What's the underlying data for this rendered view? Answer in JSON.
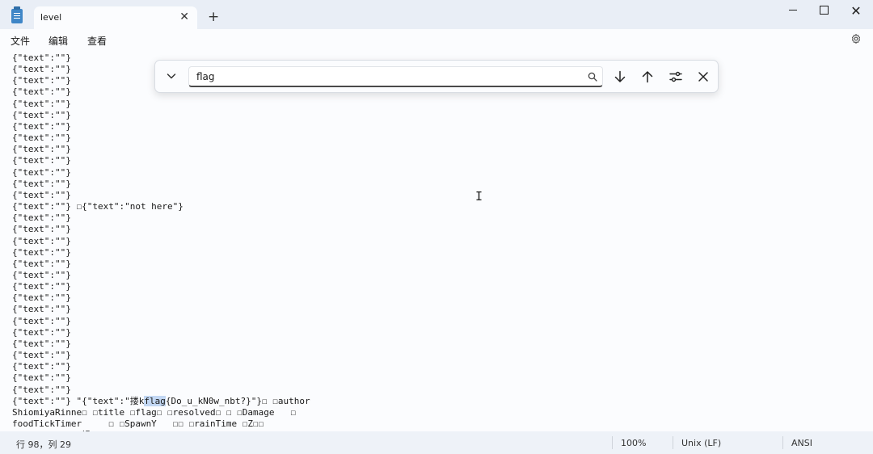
{
  "window": {
    "tab_title": "level",
    "tab_close": "✕",
    "new_tab": "+",
    "minimize": "",
    "maximize": "",
    "close": "✕"
  },
  "menu": {
    "file": "文件",
    "edit": "编辑",
    "view": "查看"
  },
  "find": {
    "query": "flag"
  },
  "editor": {
    "lines": [
      "{\"text\":\"\"}",
      "{\"text\":\"\"}",
      "{\"text\":\"\"}",
      "{\"text\":\"\"}",
      "{\"text\":\"\"}",
      "{\"text\":\"\"}",
      "{\"text\":\"\"}",
      "{\"text\":\"\"}",
      "{\"text\":\"\"}",
      "{\"text\":\"\"}",
      "{\"text\":\"\"}",
      "{\"text\":\"\"}",
      "{\"text\":\"\"}",
      "{\"text\":\"\"} ☐{\"text\":\"not here\"}",
      "{\"text\":\"\"}",
      "{\"text\":\"\"}",
      "{\"text\":\"\"}",
      "{\"text\":\"\"}",
      "{\"text\":\"\"}",
      "{\"text\":\"\"}",
      "{\"text\":\"\"}",
      "{\"text\":\"\"}",
      "{\"text\":\"\"}",
      "{\"text\":\"\"}",
      "{\"text\":\"\"}",
      "{\"text\":\"\"}",
      "{\"text\":\"\"}",
      "{\"text\":\"\"}",
      "{\"text\":\"\"}",
      "{\"text\":\"\"}"
    ],
    "flag_line": {
      "before": "{\"text\":\"\"} \"{\"text\":\"搂k",
      "match": "flag",
      "after": "{Do_u_kN0w_nbt?}\"}☐ ☐author"
    },
    "tail_lines": [
      "ShiomiyaRinne☐ ☐title ☐flag☐ ☐resolved☐ ☐ ☐Damage   ☐",
      "foodTickTimer     ☐ ☐SpawnY   ☐☐ ☐rainTime ☐Z☐☐",
      "thunderTime ☐禍☐ ☐SpawnZ   ? ☐hardcore ☐ ☐DifficultyLocked ☐ ☐SpawnX · · · ☐ ☐clearWeatherTime    ☐"
    ]
  },
  "status": {
    "position": "行 98，列 29",
    "zoom": "100%",
    "line_ending": "Unix (LF)",
    "encoding": "ANSI"
  }
}
